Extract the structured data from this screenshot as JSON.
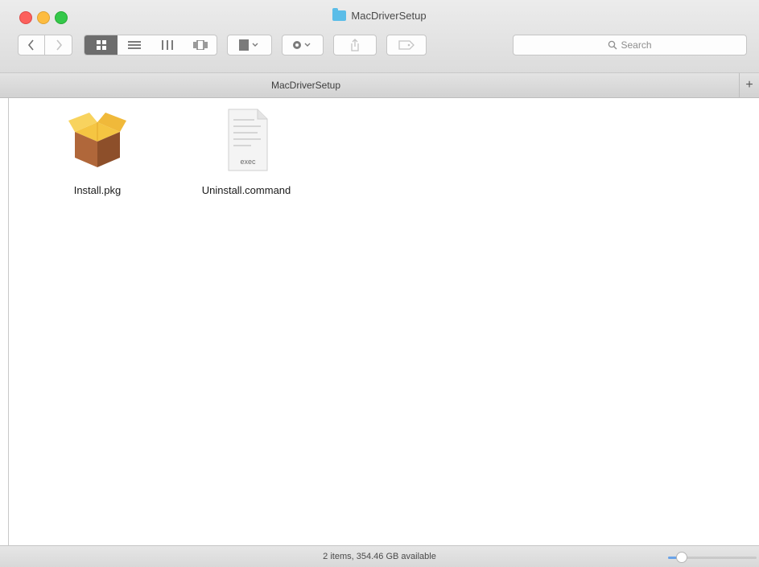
{
  "window": {
    "title": "MacDriverSetup"
  },
  "toolbar": {
    "back_icon": "chevron-left-icon",
    "forward_icon": "chevron-right-icon",
    "view_modes": [
      "icon-view",
      "list-view",
      "column-view",
      "cover-flow-view"
    ],
    "active_view": "icon-view",
    "arrange_icon": "arrange-icon",
    "action_icon": "gear-icon",
    "share_icon": "share-icon",
    "tags_icon": "tag-icon"
  },
  "search": {
    "placeholder": "Search"
  },
  "pathbar": {
    "label": "MacDriverSetup",
    "add_tab": "+"
  },
  "files": [
    {
      "name": "Install.pkg",
      "icon": "package-icon"
    },
    {
      "name": "Uninstall.command",
      "icon": "script-file-icon",
      "badge": "exec"
    }
  ],
  "status": {
    "text": "2 items, 354.46 GB available"
  },
  "icon_size": {
    "value": 0.15
  },
  "colors": {
    "accent": "#6aa3e8",
    "close": "#fc605c",
    "minimize": "#fdbc40",
    "maximize": "#34c84a",
    "folder": "#5bbde8"
  }
}
